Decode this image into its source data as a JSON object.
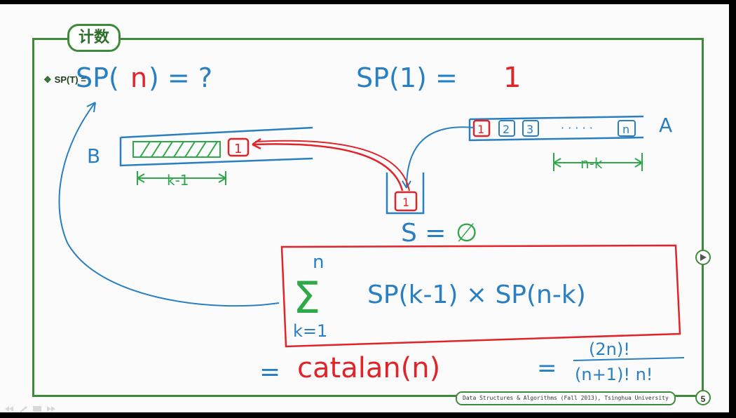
{
  "slide": {
    "title": "计数",
    "bullet_marker": "❖",
    "bullet_text": "SP(T) =",
    "footer": "Data Structures & Algorithms (Fall 2013), Tsinghua University",
    "page_number": "5"
  },
  "annotations": {
    "sp_n": "SP(",
    "sp_n_var": "n",
    "sp_n_tail": ") = ?",
    "sp_1": "SP(1) =",
    "sp_1_val": "1",
    "label_b": "B",
    "label_a": "A",
    "label_k_minus_1": "k-1",
    "label_n_minus_k": "n-k",
    "stack_label_s": "S =",
    "stack_label_empty": "∅",
    "elem_1": "1",
    "elem_2": "2",
    "elem_3": "3",
    "elem_dots": "· · · · ·",
    "elem_n": "n",
    "sum_upper": "n",
    "sum_symbol": "Σ",
    "sum_lower": "k=1",
    "sum_body": "SP(k-1) × SP(n-k)",
    "catalan_eq": "=",
    "catalan_text": "catalan(n)",
    "equals": "=",
    "fraction_num": "(2n)!",
    "fraction_den": "(n+1)! n!"
  },
  "colors": {
    "frame_green": "#3f8a3a",
    "ink_blue": "#2a7fc1",
    "ink_red": "#e0242a",
    "ink_green": "#2fa84a"
  },
  "toolbar": {
    "icons": [
      "prev-icon",
      "pen-icon",
      "menu-icon",
      "next-icon"
    ]
  }
}
